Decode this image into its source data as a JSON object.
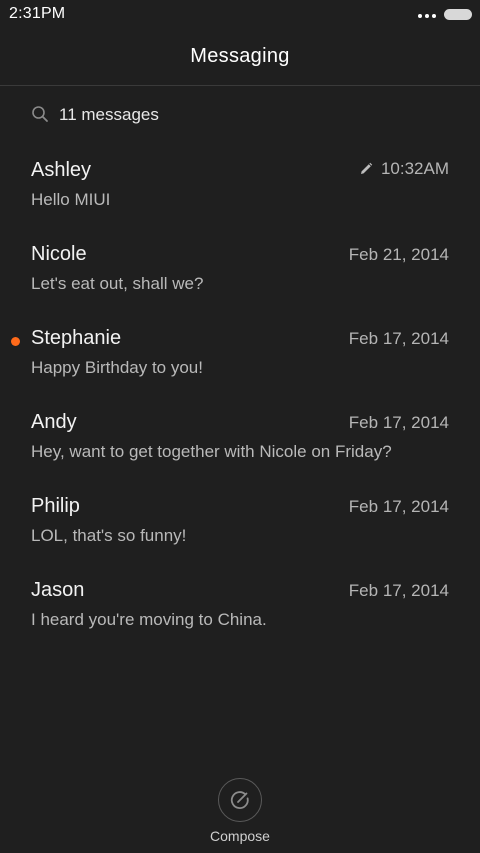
{
  "status_bar": {
    "time": "2:31PM"
  },
  "header": {
    "title": "Messaging"
  },
  "search": {
    "label": "11 messages"
  },
  "conversations": [
    {
      "name": "Ashley",
      "time": "10:32AM",
      "preview": "Hello MIUI"
    },
    {
      "name": "Nicole",
      "time": "Feb 21, 2014",
      "preview": "Let's eat out, shall we?"
    },
    {
      "name": "Stephanie",
      "time": "Feb 17, 2014",
      "preview": "Happy Birthday to you!"
    },
    {
      "name": "Andy",
      "time": "Feb 17, 2014",
      "preview": "Hey, want to get together with Nicole on Friday?"
    },
    {
      "name": "Philip",
      "time": "Feb 17, 2014",
      "preview": "LOL, that's so funny!"
    },
    {
      "name": "Jason",
      "time": "Feb 17, 2014",
      "preview": "I heard you're moving to China."
    }
  ],
  "compose": {
    "label": "Compose"
  },
  "icons": {
    "status_menu": "more-dots-icon",
    "battery": "battery-icon",
    "search": "search-icon",
    "draft": "pencil-icon",
    "compose": "compose-icon"
  },
  "colors": {
    "background": "#1f1f1f",
    "unread_indicator": "#ff6a1a",
    "secondary_text": "#b5b5b5"
  }
}
